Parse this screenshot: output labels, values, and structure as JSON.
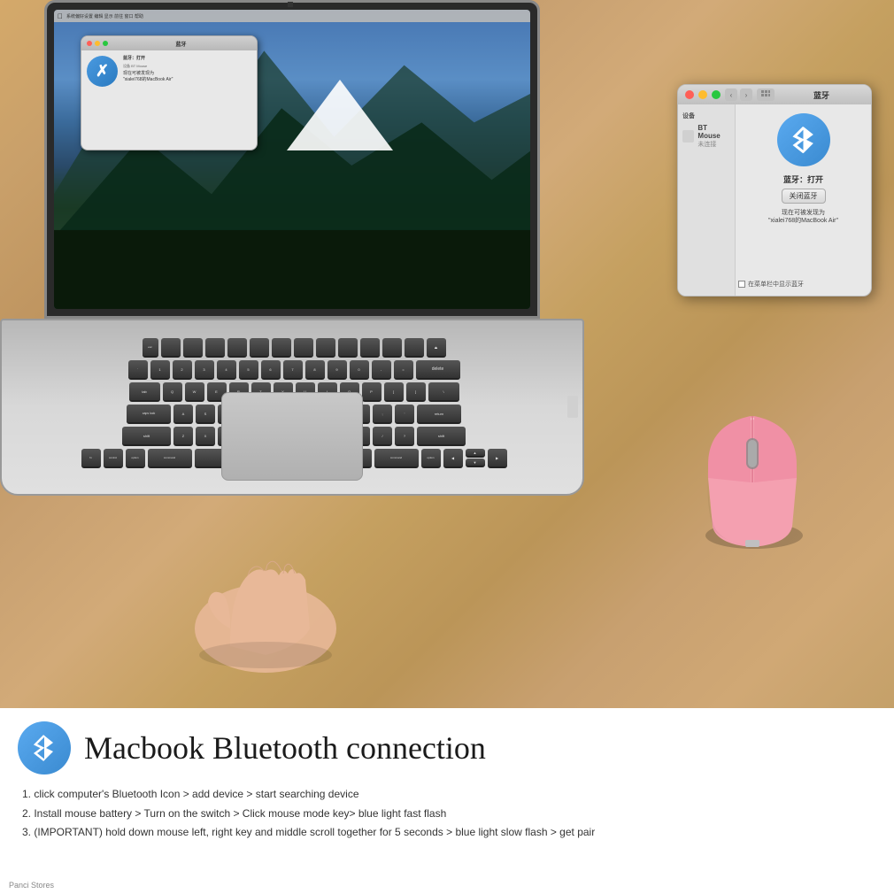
{
  "page": {
    "background_color": "#c8a97a"
  },
  "bluetooth_dialog": {
    "title": "蓝牙",
    "status_label": "蓝牙：打开",
    "discoverable_text": "现在可被发现为",
    "device_name": "\"xialei768的MacBook Air\"",
    "toggle_button": "关闭蓝牙",
    "device_label": "BT Mouse",
    "device_status": "未连接",
    "devices_section": "设备",
    "menu_checkbox": "在菜单栏中显示蓝牙"
  },
  "info_section": {
    "title": "Macbook Bluetooth connection",
    "step1": "1. click computer's  Bluetooth Icon  > add device > start searching device",
    "step2": "2. Install mouse battery > Turn on the switch > Click mouse mode key> blue light fast flash",
    "step3": "3. (IMPORTANT) hold down mouse left, right key and middle scroll   together for 5 seconds >  blue light slow flash > get pair",
    "store_label": "Panci Stores"
  },
  "icons": {
    "bluetooth": "✦",
    "back_arrow": "‹",
    "forward_arrow": "›"
  }
}
